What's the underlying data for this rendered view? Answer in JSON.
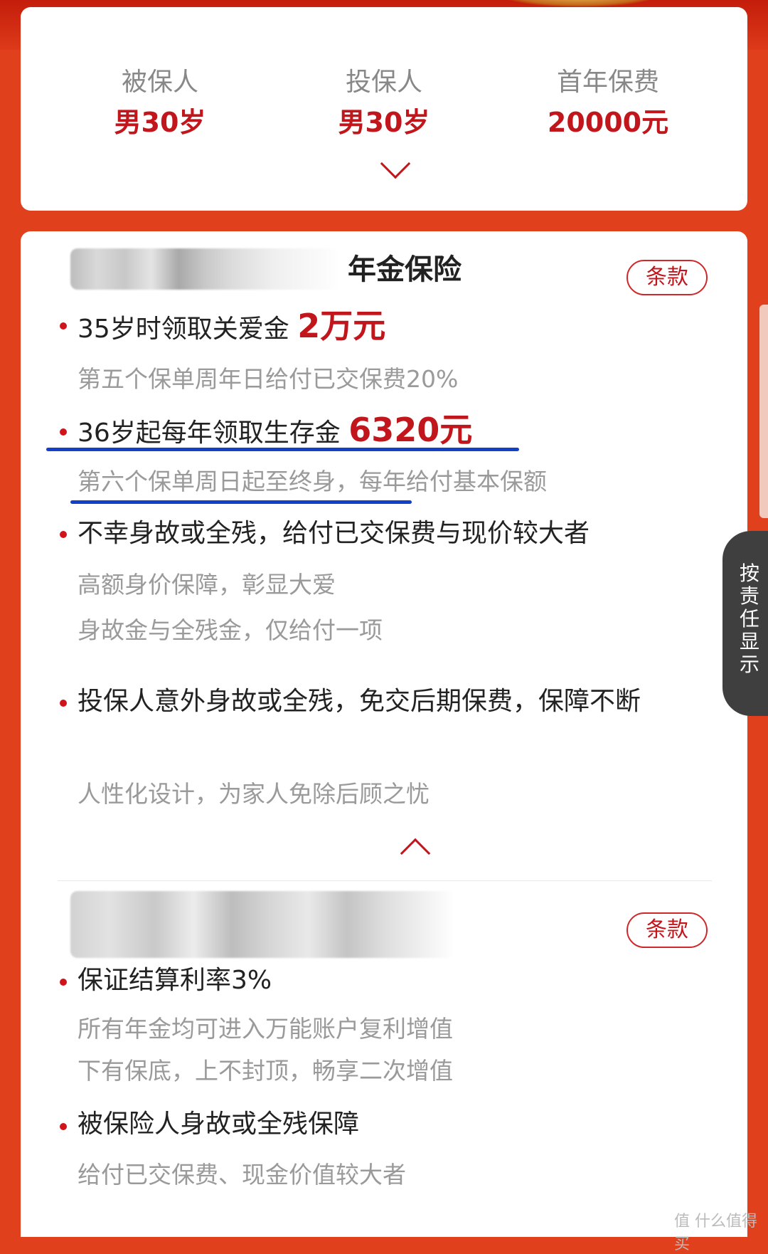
{
  "summary": {
    "insured": {
      "label": "被保人",
      "value": "男30岁"
    },
    "policyholder": {
      "label": "投保人",
      "value": "男30岁"
    },
    "first_year_premium": {
      "label": "首年保费",
      "value": "20000元"
    }
  },
  "product1": {
    "title_suffix": "年金保险",
    "terms_label": "条款",
    "items": [
      {
        "prefix": "35岁时领取关爱金 ",
        "highlight": "2万元",
        "subs": [
          "第五个保单周年日给付已交保费20%"
        ]
      },
      {
        "prefix": "36岁起每年领取生存金 ",
        "highlight": "6320元",
        "subs": [
          "第六个保单周日起至终身，每年给付基本保额"
        ]
      },
      {
        "text": "不幸身故或全残，给付已交保费与现价较大者",
        "subs": [
          "高额身价保障，彰显大爱",
          "身故金与全残金，仅给付一项"
        ]
      },
      {
        "text": "投保人意外身故或全残，免交后期保费，保障不断",
        "subs": [
          "人性化设计，为家人免除后顾之忧"
        ]
      }
    ]
  },
  "product2": {
    "terms_label": "条款",
    "items": [
      {
        "text": "保证结算利率3%",
        "subs": [
          "所有年金均可进入万能账户复利增值",
          "下有保底，上不封顶，畅享二次增值"
        ]
      },
      {
        "text": "被保险人身故或全残保障",
        "subs": [
          "给付已交保费、现金价值较大者"
        ]
      }
    ]
  },
  "side_tab": {
    "label": "按责任显示"
  },
  "watermark": "值 什么值得买",
  "colors": {
    "accent": "#c0161c",
    "background": "#e0401c",
    "annotation": "#1340c8"
  },
  "icons": {
    "expand": "chevron-down-icon",
    "collapse": "chevron-up-icon"
  }
}
